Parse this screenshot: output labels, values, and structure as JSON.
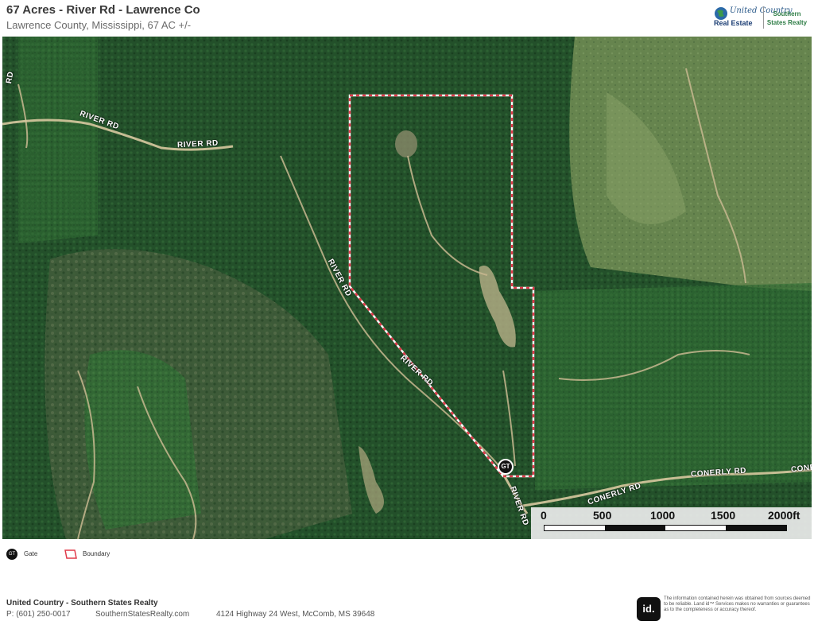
{
  "header": {
    "title": "67 Acres - River Rd - Lawrence Co",
    "subtitle": "Lawrence County, Mississippi, 67 AC +/-",
    "logo": {
      "united_country": "United Country",
      "real_estate": "Real Estate",
      "southern_line1": "Southern",
      "southern_line2": "States Realty"
    }
  },
  "map": {
    "road_labels": {
      "river_rd_a": "RIVER RD",
      "river_rd_b": "RIVER RD",
      "river_rd_c": "RIVER RD",
      "river_rd_d": "RIVER RD",
      "river_rd_e": "RIVER RD",
      "conerly_rd_a": "CONERLY RD",
      "conerly_rd_b": "CONERLY RD",
      "cone_partial": "CONE",
      "rd_partial": "RD"
    },
    "gate_marker_icon": "gate-icon",
    "boundary_color": "#e03a4a",
    "scalebar": {
      "labels": [
        "0",
        "500",
        "1000",
        "1500",
        "2000ft"
      ]
    }
  },
  "legend": {
    "gate_label": "Gate",
    "boundary_label": "Boundary"
  },
  "footer": {
    "company": "United Country - Southern States Realty",
    "phone": "P: (601) 250-0017",
    "website": "SouthernStatesRealty.com",
    "address": "4124 Highway 24 West, McComb, MS 39648",
    "id_logo": "id.",
    "disclaimer": "The information contained herein was obtained from sources deemed to be reliable. Land id™ Services makes no warranties or guarantees as to the completeness or accuracy thereof."
  }
}
